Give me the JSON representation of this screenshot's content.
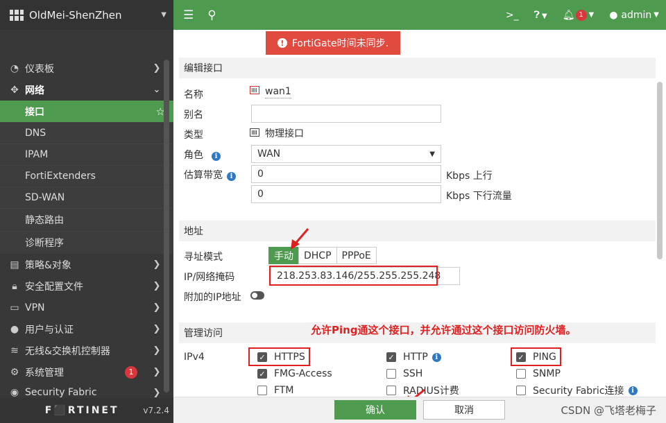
{
  "sidebar": {
    "device_name": "OldMei-ShenZhen",
    "items": [
      {
        "icon": "dashboard-icon",
        "label": "仪表板"
      },
      {
        "icon": "network-icon",
        "label": "网络"
      },
      {
        "icon": "policy-icon",
        "label": "策略&对象"
      },
      {
        "icon": "lock-icon",
        "label": "安全配置文件"
      },
      {
        "icon": "monitor-icon",
        "label": "VPN"
      },
      {
        "icon": "user-icon",
        "label": "用户与认证"
      },
      {
        "icon": "wifi-icon",
        "label": "无线&交换机控制器"
      },
      {
        "icon": "gear-icon",
        "label": "系统管理",
        "badge": "1"
      },
      {
        "icon": "fabric-icon",
        "label": "Security Fabric"
      }
    ],
    "network_sub": [
      "接口",
      "DNS",
      "IPAM",
      "FortiExtenders",
      "SD-WAN",
      "静态路由",
      "诊断程序"
    ],
    "brand": "F⬛RTINET",
    "version": "v7.2.4"
  },
  "topbar": {
    "notifications": "1",
    "user": "admin"
  },
  "alert": {
    "text": "FortiGate时间未同步."
  },
  "form": {
    "section_edit": "编辑接口",
    "name_label": "名称",
    "name_value": "wan1",
    "alias_label": "别名",
    "alias_value": "",
    "type_label": "类型",
    "type_value": "物理接口",
    "role_label": "角色",
    "role_value": "WAN",
    "bw_label": "估算带宽",
    "bw_up": "0",
    "bw_up_unit": "Kbps 上行",
    "bw_down": "0",
    "bw_down_unit": "Kbps 下行流量",
    "section_addr": "地址",
    "addr_mode_label": "寻址模式",
    "addr_modes": [
      "手动",
      "DHCP",
      "PPPoE"
    ],
    "ip_label": "IP/网络掩码",
    "ip_value": "218.253.83.146/255.255.255.248",
    "extra_ip_label": "附加的IP地址",
    "section_admin": "管理访问",
    "ipv4_label": "IPv4",
    "annotation": "允许Ping通这个接口，并允许通过这个接口访问防火墙。",
    "access": [
      {
        "label": "HTTPS",
        "checked": true
      },
      {
        "label": "HTTP",
        "checked": true
      },
      {
        "label": "PING",
        "checked": true
      },
      {
        "label": "FMG-Access",
        "checked": true
      },
      {
        "label": "SSH",
        "checked": false
      },
      {
        "label": "SNMP",
        "checked": false
      },
      {
        "label": "FTM",
        "checked": false
      },
      {
        "label": "RADIUS计费",
        "checked": false
      },
      {
        "label": "Security Fabric连接",
        "checked": false
      }
    ]
  },
  "footer": {
    "ok_label": "确认",
    "cancel_label": "取消",
    "watermark": "CSDN @飞塔老梅子"
  },
  "colors": {
    "accent": "#4e9a4e",
    "sidebar_bg": "#383838",
    "alert": "#e04a3f",
    "annotation": "#e02020"
  }
}
